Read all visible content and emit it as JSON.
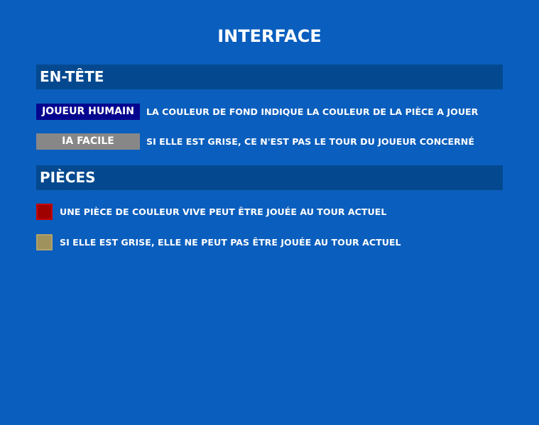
{
  "title": "Interface",
  "header_section": {
    "heading": "En-tête",
    "rows": [
      {
        "badge_label": "Joueur humain",
        "badge_color": "#05068f",
        "description": "La couleur de fond indique la couleur de la pièce a jouer"
      },
      {
        "badge_label": "IA Facile",
        "badge_color": "#878787",
        "description": "Si elle est grise, ce n'est pas le tour du joueur concerné"
      }
    ]
  },
  "pieces_section": {
    "heading": "Pièces",
    "rows": [
      {
        "swatch_color": "#9f0000",
        "description": "Une pièce de couleur vive peut être jouée au tour actuel"
      },
      {
        "swatch_color": "#a0925c",
        "description": "Si elle est grise, elle ne peut pas être jouée au tour actuel"
      }
    ]
  },
  "colors": {
    "background": "#0a5ebd",
    "section_header": "#04498f",
    "text": "#ffffff"
  }
}
